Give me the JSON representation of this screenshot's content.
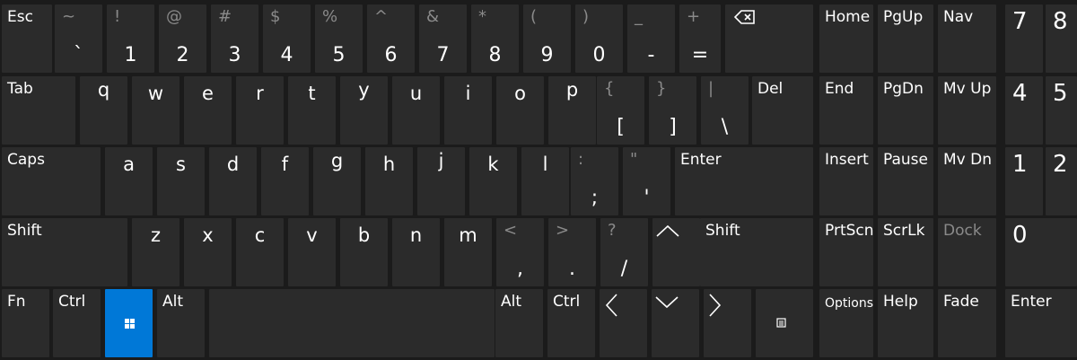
{
  "rows": [
    [
      {
        "label": "Esc"
      },
      {
        "sec": "~",
        "prim": "`"
      },
      {
        "sec": "!",
        "prim": "1"
      },
      {
        "sec": "@",
        "prim": "2"
      },
      {
        "sec": "#",
        "prim": "3"
      },
      {
        "sec": "$",
        "prim": "4"
      },
      {
        "sec": "%",
        "prim": "5"
      },
      {
        "sec": "^",
        "prim": "6"
      },
      {
        "sec": "&",
        "prim": "7"
      },
      {
        "sec": "*",
        "prim": "8"
      },
      {
        "sec": "(",
        "prim": "9"
      },
      {
        "sec": ")",
        "prim": "0"
      },
      {
        "sec": "_",
        "prim": "-"
      },
      {
        "sec": "+",
        "prim": "="
      },
      {
        "icon": "backspace-icon"
      },
      {
        "label": "Home"
      },
      {
        "label": "PgUp"
      },
      {
        "label": "Nav"
      },
      {
        "big": "7"
      },
      {
        "big": "8"
      }
    ],
    [
      {
        "label": "Tab"
      },
      {
        "letter": "q"
      },
      {
        "letter": "w"
      },
      {
        "letter": "e"
      },
      {
        "letter": "r"
      },
      {
        "letter": "t"
      },
      {
        "letter": "y"
      },
      {
        "letter": "u"
      },
      {
        "letter": "i"
      },
      {
        "letter": "o"
      },
      {
        "letter": "p"
      },
      {
        "sec": "{",
        "prim": "["
      },
      {
        "sec": "}",
        "prim": "]"
      },
      {
        "sec": "|",
        "prim": "\\"
      },
      {
        "label": "Del"
      },
      {
        "label": "End"
      },
      {
        "label": "PgDn"
      },
      {
        "label": "Mv Up"
      },
      {
        "big": "4"
      },
      {
        "big": "5"
      }
    ],
    [
      {
        "label": "Caps"
      },
      {
        "letter": "a"
      },
      {
        "letter": "s"
      },
      {
        "letter": "d"
      },
      {
        "letter": "f"
      },
      {
        "letter": "g"
      },
      {
        "letter": "h"
      },
      {
        "letter": "j"
      },
      {
        "letter": "k"
      },
      {
        "letter": "l"
      },
      {
        "sec": ":",
        "prim": ";"
      },
      {
        "sec": "\"",
        "prim": "'"
      },
      {
        "label": "Enter"
      },
      {
        "label": "Insert"
      },
      {
        "label": "Pause"
      },
      {
        "label": "Mv Dn"
      },
      {
        "big": "1"
      },
      {
        "big": "2"
      }
    ],
    [
      {
        "label": "Shift"
      },
      {
        "letter": "z"
      },
      {
        "letter": "x"
      },
      {
        "letter": "c"
      },
      {
        "letter": "v"
      },
      {
        "letter": "b"
      },
      {
        "letter": "n"
      },
      {
        "letter": "m"
      },
      {
        "sec": "<",
        "prim": ","
      },
      {
        "sec": ">",
        "prim": "."
      },
      {
        "sec": "?",
        "prim": "/"
      },
      {
        "icon": "arrow-up-icon"
      },
      {
        "label": "Shift"
      },
      {
        "label": "PrtScn"
      },
      {
        "label": "ScrLk"
      },
      {
        "label": "Dock",
        "dim": true
      },
      {
        "big": "0"
      }
    ],
    [
      {
        "label": "Fn"
      },
      {
        "label": "Ctrl"
      },
      {
        "icon": "windows-icon",
        "accent": "#0078d7"
      },
      {
        "label": "Alt"
      },
      {
        "label": ""
      },
      {
        "label": "Alt"
      },
      {
        "label": "Ctrl"
      },
      {
        "icon": "arrow-left-icon"
      },
      {
        "icon": "arrow-down-icon"
      },
      {
        "icon": "arrow-right-icon"
      },
      {
        "icon": "menu-icon"
      },
      {
        "label": "Options",
        "small": true
      },
      {
        "label": "Help"
      },
      {
        "label": "Fade"
      },
      {
        "label": "Enter"
      }
    ]
  ],
  "colors": {
    "background": "#1b1b1b",
    "key": "#2b2b2b",
    "accent": "#0078d7",
    "text": "#ffffff",
    "secondary": "#8a8a8a"
  }
}
